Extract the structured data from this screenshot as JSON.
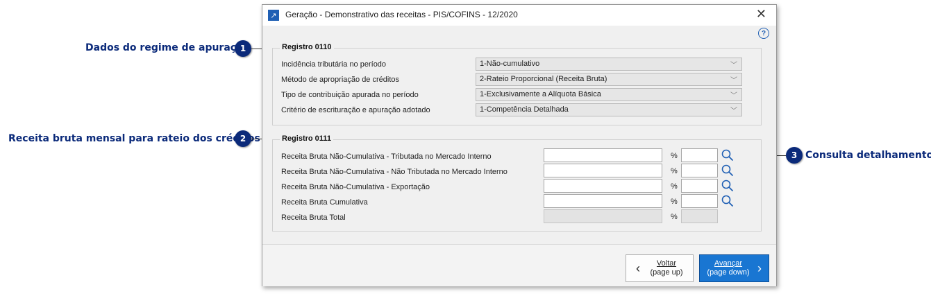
{
  "callouts": [
    {
      "number": "1",
      "label": "Dados do regime de apuração"
    },
    {
      "number": "2",
      "label": "Receita bruta mensal para rateio dos créditos"
    },
    {
      "number": "3",
      "label": "Consulta detalhamento"
    }
  ],
  "window": {
    "title": "Geração - Demonstrativo das receitas - PIS/COFINS - 12/2020",
    "close_glyph": "✕",
    "help_glyph": "?"
  },
  "registro_0110": {
    "title": "Registro 0110",
    "fields": [
      {
        "label": "Incidência tributária no período",
        "value": "1-Não-cumulativo"
      },
      {
        "label": "Método de apropriação de créditos",
        "value": "2-Rateio Proporcional (Receita Bruta)"
      },
      {
        "label": "Tipo de contribuição apurada no período",
        "value": "1-Exclusivamente a Alíquota Básica"
      },
      {
        "label": "Critério de escrituração e apuração adotado",
        "value": "1-Competência Detalhada"
      }
    ]
  },
  "registro_0111": {
    "title": "Registro 0111",
    "percent_symbol": "%",
    "rows": [
      {
        "label": "Receita Bruta Não-Cumulativa - Tributada no Mercado Interno",
        "value": "",
        "percent": ""
      },
      {
        "label": "Receita Bruta Não-Cumulativa - Não Tributada no Mercado Interno",
        "value": "",
        "percent": ""
      },
      {
        "label": "Receita Bruta Não-Cumulativa - Exportação",
        "value": "",
        "percent": ""
      },
      {
        "label": "Receita Bruta Cumulativa",
        "value": "",
        "percent": ""
      },
      {
        "label": "Receita Bruta Total",
        "value": "",
        "percent": ""
      }
    ]
  },
  "buttons": {
    "back_line1": "Voltar",
    "back_line2": "(page up)",
    "next_line1": "Avançar",
    "next_line2": "(page down)"
  },
  "colors": {
    "accent": "#1976d2",
    "callout": "#0b2a7a"
  }
}
